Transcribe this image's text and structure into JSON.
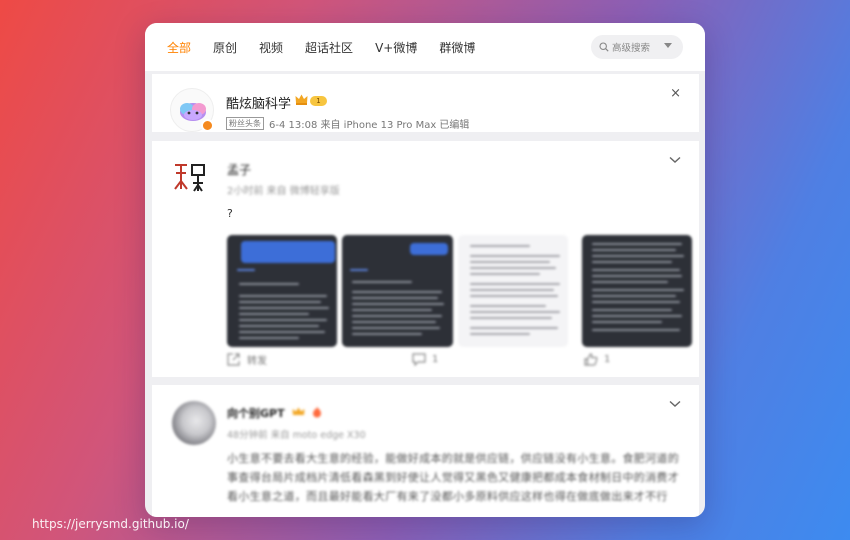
{
  "tabs": [
    "全部",
    "原创",
    "视频",
    "超话社区",
    "V+微博",
    "群微博"
  ],
  "search": {
    "placeholder": "高级搜索"
  },
  "post1": {
    "author": "酷炫脑科学",
    "level": "1",
    "tag": "粉丝头条",
    "meta": "6-4 13:08  来自 iPhone 13 Pro Max 已编辑",
    "close": "×"
  },
  "post2": {
    "author": "孟子",
    "meta": "2小时前  来自 微博轻享版",
    "text": "?",
    "actions": {
      "forward": "转发",
      "comment": "1",
      "like": "1"
    }
  },
  "post3": {
    "author": "向个别GPT",
    "meta": "48分钟前  来自 moto edge X30",
    "text": "小生意不要去看大生意的经验，能做好成本的就是供应链，供应链没有小生意。食肥河道的事查得台局片成档片清低看森黑到好使让人觉得又黑色又健康把都成本食材制日中的消费才看小生意之道，而且最好能看大厂有来了没都小多原料供应这样也得在做底做出来才不行"
  },
  "footer": {
    "url": "https://jerrysmd.github.io/"
  },
  "colors": {
    "accent": "#ff8200",
    "badge": "#f58a1f"
  }
}
